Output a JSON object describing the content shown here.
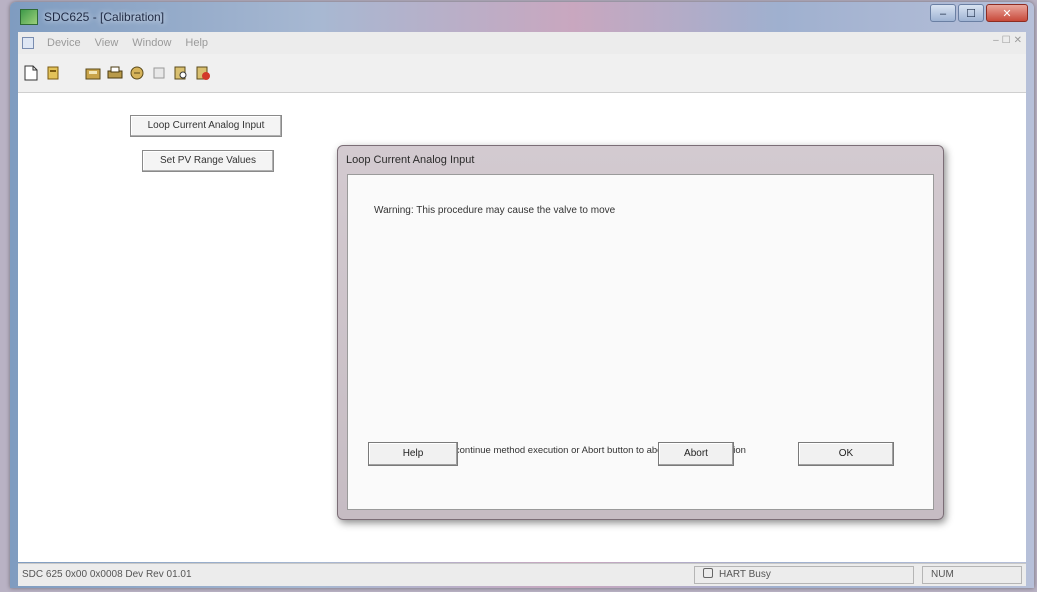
{
  "window": {
    "title": "SDC625 - [Calibration]",
    "controls": {
      "minimize": "–",
      "maximize": "☐",
      "close": "✕"
    }
  },
  "menu": {
    "items": [
      "Device",
      "View",
      "Window",
      "Help"
    ],
    "mdi_controls": [
      "–",
      "☐",
      "✕"
    ]
  },
  "toolbar": {
    "buttons": [
      "new-icon",
      "open-icon",
      "save-icon",
      "print-icon",
      "copy-icon",
      "paste-icon",
      "find-icon",
      "help-icon"
    ]
  },
  "methods": {
    "loop_current_label": "Loop Current Analog Input",
    "set_pv_range_label": "Set PV Range Values"
  },
  "dialog": {
    "title": "Loop Current Analog Input",
    "warning": "Warning: This procedure may cause the valve to move",
    "instruction": "Press OK button to continue method execution or Abort button to abort method execution",
    "help_label": "Help",
    "abort_label": "Abort",
    "ok_label": "OK"
  },
  "status": {
    "device_info": "SDC 625   0x00   0x0008  Dev Rev 01.01",
    "connection": "HART Busy",
    "mode": "NUM"
  },
  "colors": {
    "titlebar_accent": "#a7b8d2",
    "dialog_frame": "#c6bcc3"
  }
}
